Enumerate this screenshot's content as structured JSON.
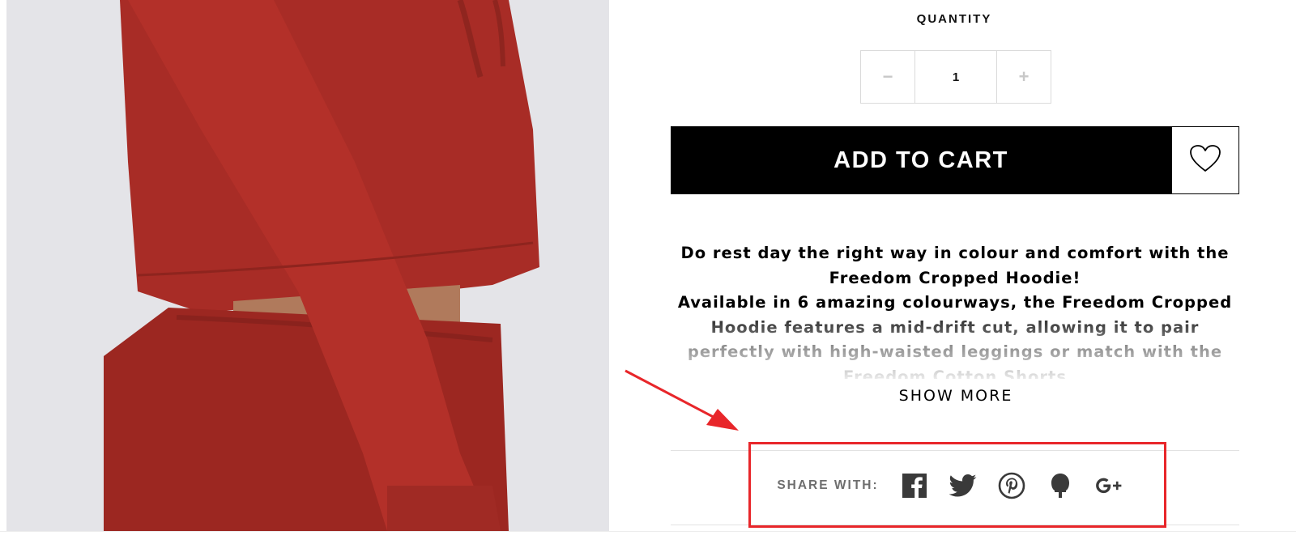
{
  "product_image": {
    "alt": "",
    "accent": "#a82c26",
    "background": "#e4e4e8"
  },
  "quantity": {
    "label": "QUANTITY",
    "value": "1",
    "minus_symbol": "−",
    "plus_symbol": "+"
  },
  "actions": {
    "add_to_cart": "ADD TO CART",
    "wishlist_icon": "heart-icon"
  },
  "description": {
    "lines": [
      "Do rest day the right way in colour and comfort with the Freedom Cropped Hoodie!",
      "Available in 6 amazing colourways, the Freedom Cropped Hoodie features a mid-drift cut, allowing it to pair perfectly with high-waisted leggings or match with the Freedom Cotton Shorts"
    ],
    "show_more": "SHOW MORE"
  },
  "share": {
    "label": "SHARE WITH:",
    "icons": [
      "facebook-icon",
      "twitter-icon",
      "pinterest-icon",
      "fancy-icon",
      "google-plus-icon"
    ]
  },
  "annotation": {
    "color": "#e8262a"
  }
}
